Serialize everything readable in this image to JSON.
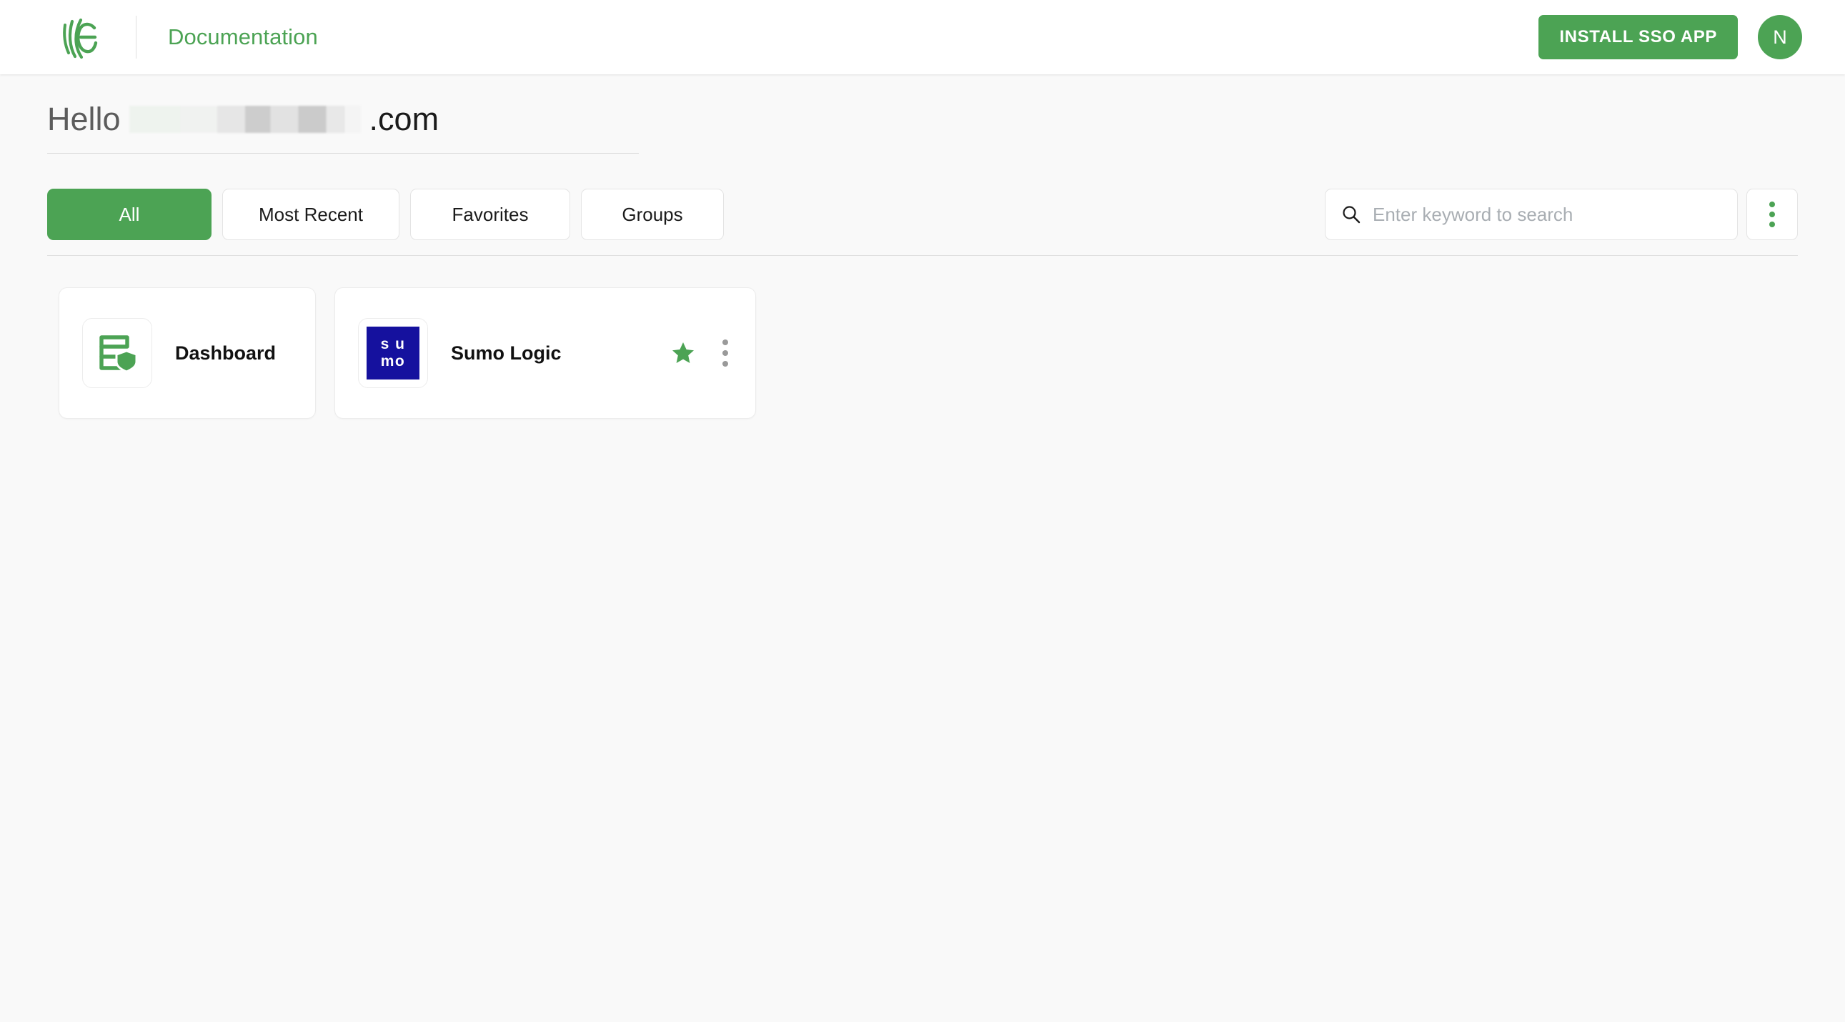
{
  "header": {
    "logo_icon": "brand-swirl-e-logo",
    "title": "Documentation",
    "install_button_label": "INSTALL SSO APP",
    "avatar_initial": "N",
    "accent_color": "#4CA354"
  },
  "greeting": {
    "hello_text": "Hello",
    "redacted_value": "",
    "domain_suffix": ".com"
  },
  "controls": {
    "tabs": [
      {
        "label": "All",
        "active": true
      },
      {
        "label": "Most Recent",
        "active": false
      },
      {
        "label": "Favorites",
        "active": false
      },
      {
        "label": "Groups",
        "active": false
      }
    ],
    "search": {
      "placeholder": "Enter keyword to search",
      "value": "",
      "icon": "search-icon"
    },
    "overflow_icon": "kebab-menu-icon"
  },
  "apps": [
    {
      "name": "Dashboard",
      "icon": "dashboard-shield-icon",
      "favorite": false,
      "has_menu": false
    },
    {
      "name": "Sumo Logic",
      "icon": "sumo-logic-logo",
      "logo_line1": "s u",
      "logo_line2": "mo",
      "logo_bg": "#15119e",
      "favorite": true,
      "favorite_icon": "star-filled-icon",
      "has_menu": true,
      "menu_icon": "kebab-menu-icon"
    }
  ]
}
